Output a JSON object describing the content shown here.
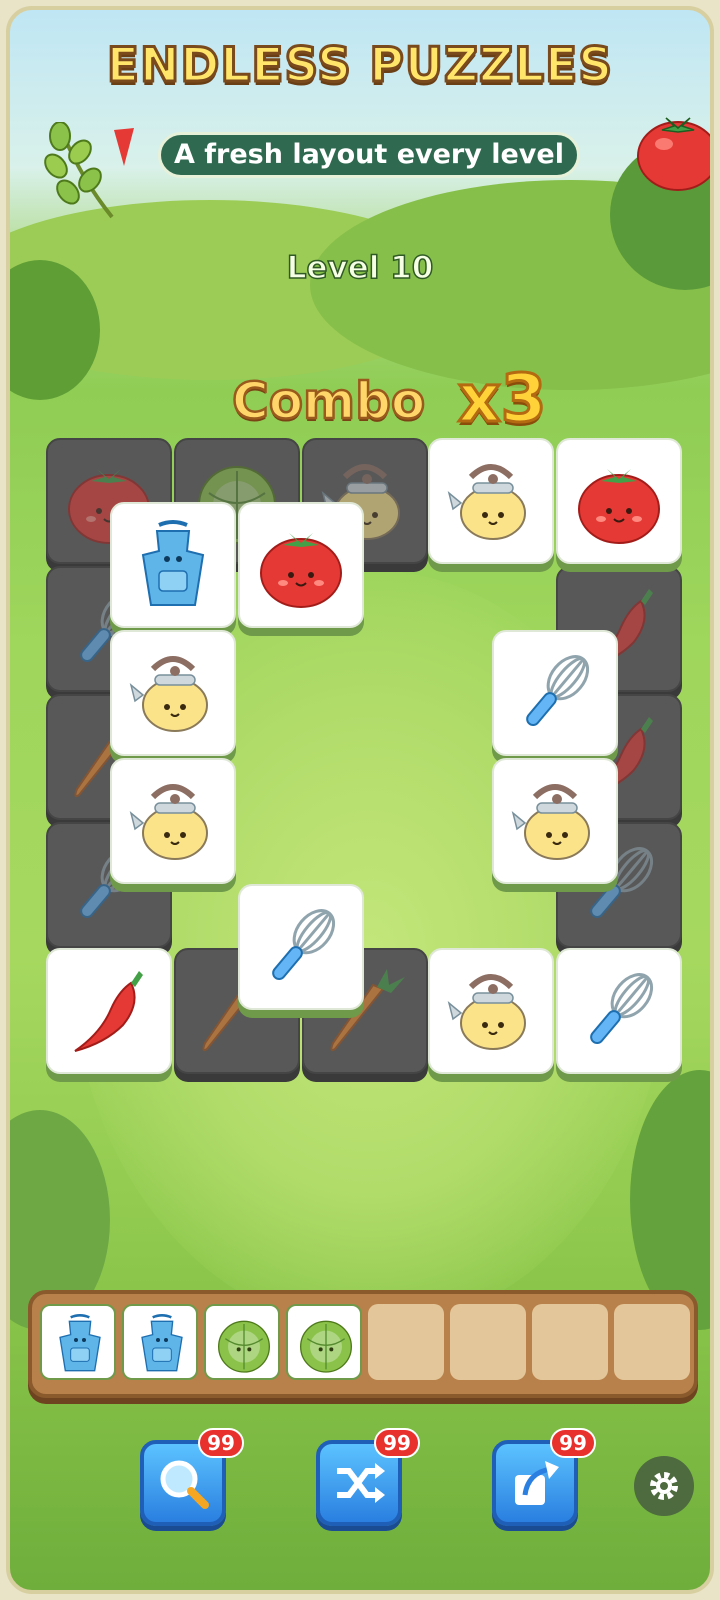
{
  "header": {
    "title": "ENDLESS PUZZLES",
    "subtitle": "A fresh layout every level",
    "level_label": "Level 10"
  },
  "combo": {
    "label": "Combo",
    "multiplier": "x3"
  },
  "board": {
    "tiles": [
      {
        "item": "tomato",
        "covered": true
      },
      {
        "item": "cabbage",
        "covered": true
      },
      {
        "item": "kettle",
        "covered": true
      },
      {
        "item": "kettle",
        "covered": false
      },
      {
        "item": "tomato",
        "covered": false
      },
      {
        "item": "apron",
        "covered": false
      },
      {
        "item": "tomato",
        "covered": false
      },
      {
        "item": "whisk",
        "covered": true
      },
      {
        "item": "chili",
        "covered": true
      },
      {
        "item": "kettle",
        "covered": false
      },
      {
        "item": "whisk",
        "covered": false
      },
      {
        "item": "carrot",
        "covered": true
      },
      {
        "item": "chili",
        "covered": true
      },
      {
        "item": "kettle",
        "covered": false
      },
      {
        "item": "kettle",
        "covered": false
      },
      {
        "item": "whisk",
        "covered": true
      },
      {
        "item": "whisk",
        "covered": true
      },
      {
        "item": "whisk",
        "covered": false
      },
      {
        "item": "chili",
        "covered": false
      },
      {
        "item": "carrot",
        "covered": true
      },
      {
        "item": "carrot",
        "covered": true
      },
      {
        "item": "kettle",
        "covered": false
      },
      {
        "item": "whisk",
        "covered": false
      }
    ]
  },
  "tray": {
    "capacity": 8,
    "slots": [
      "apron",
      "apron",
      "cabbage",
      "cabbage",
      "",
      "",
      "",
      ""
    ]
  },
  "powerups": [
    {
      "name": "hint",
      "icon": "magnifier-icon",
      "count": "99"
    },
    {
      "name": "shuffle",
      "icon": "shuffle-icon",
      "count": "99"
    },
    {
      "name": "undo",
      "icon": "undo-arrow-icon",
      "count": "99"
    }
  ],
  "colors": {
    "title_fill": "#ffe56a",
    "pill_bg": "#2f6a50",
    "badge": "#e8302c",
    "powerup": "#2a7fe0",
    "tile_base": "#6f9a4a"
  }
}
